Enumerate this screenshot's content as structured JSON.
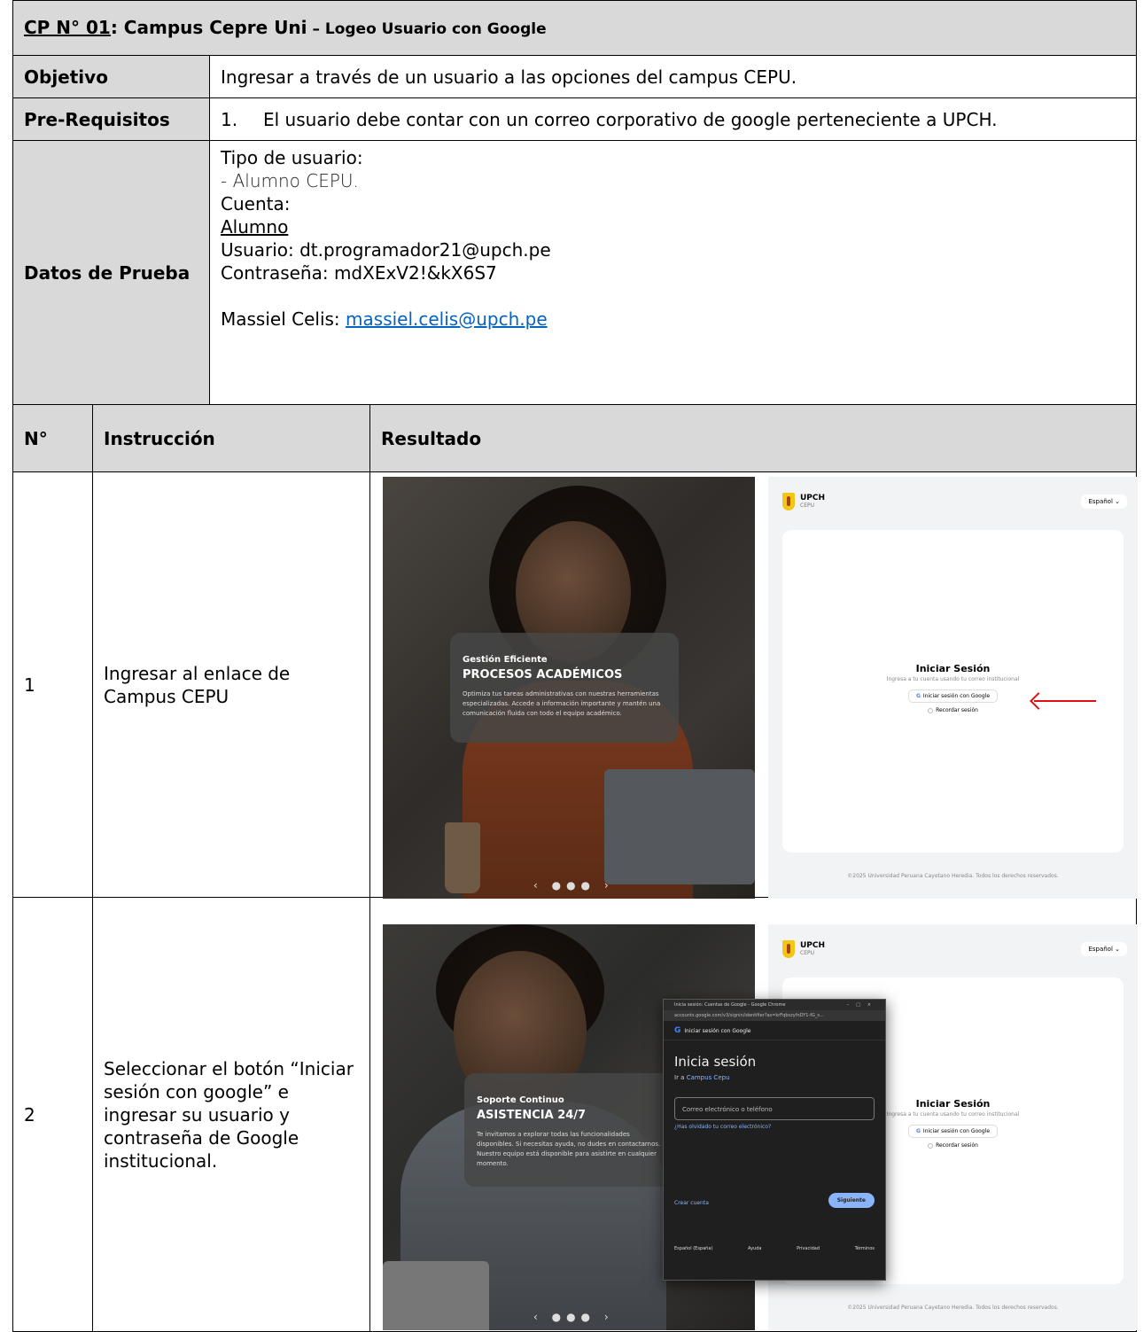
{
  "header": {
    "cp": "CP N° 01",
    "title_main": ": Campus Cepre Uni",
    "title_small": " – Logeo Usuario con Google"
  },
  "objetivo": {
    "label": "Objetivo",
    "value": "Ingresar a través de un usuario a las opciones del campus CEPU."
  },
  "prerequisitos": {
    "label": "Pre-Requisitos",
    "num": "1.",
    "value": "El usuario debe contar con un correo corporativo de google perteneciente a UPCH."
  },
  "datos": {
    "label": "Datos de Prueba",
    "tipo_label": "Tipo de usuario:",
    "tipo_value": "- Alumno CEPU.",
    "cuenta_label": "Cuenta:",
    "cuenta_value": "Alumno",
    "usuario": "Usuario: dt.programador21@upch.pe",
    "contrasena": "Contraseña: mdXExV2!&kX6S7",
    "contacto_label": "Massiel Celis: ",
    "contacto_email": "massiel.celis@upch.pe"
  },
  "columns": {
    "num": "N°",
    "instruccion": "Instrucción",
    "resultado": "Resultado"
  },
  "steps": [
    {
      "num": "1",
      "instruccion": "Ingresar al enlace de Campus CEPU"
    },
    {
      "num": "2",
      "instruccion": "Seleccionar el botón “Iniciar sesión con google” e ingresar su usuario y contraseña de Google institucional."
    }
  ],
  "screens": {
    "brand": "UPCH",
    "brand_sub": "CEPU",
    "lang": "Español ⌄",
    "signin_title": "Iniciar Sesión",
    "signin_sub": "Ingresa a tu cuenta usando tu correo institucional",
    "google_btn": "Iniciar sesión con Google",
    "remember": "Recordar sesión",
    "footer": "©2025 Universidad Peruana Cayetano Heredia. Todos los derechos reservados.",
    "dots": "‹ ●●● ›",
    "s1_card_k1": "Gestión Eficiente",
    "s1_card_k2": "PROCESOS ACADÉMICOS",
    "s1_card_k3": "Optimiza tus tareas administrativas con nuestras herramientas especializadas. Accede a información importante y mantén una comunicación fluida con todo el equipo académico.",
    "s2_card_k1": "Soporte Continuo",
    "s2_card_k2": "ASISTENCIA 24/7",
    "s2_card_k3": "Te invitamos a explorar todas las funcionalidades disponibles. Si necesitas ayuda, no dudes en contactarnos. Nuestro equipo está disponible para asistirte en cualquier momento.",
    "popup": {
      "bar_title": "Inicia sesión: Cuentas de Google - Google Chrome",
      "bar_controls": "–□×",
      "url": "accounts.google.com/v3/signin/identifier?as=krFqbszyfnDY1-fG_s...",
      "head": "Iniciar sesión con Google",
      "title": "Inicia sesión",
      "to_prefix": "Ir a ",
      "to_link": "Campus Cepu",
      "input_placeholder": "Correo electrónico o teléfono",
      "forgot": "¿Has olvidado tu correo electrónico?",
      "create": "Crear cuenta",
      "next": "Siguiente",
      "foot_lang": "Español (España)",
      "foot_help": "Ayuda",
      "foot_privacy": "Privacidad",
      "foot_terms": "Términos"
    }
  }
}
